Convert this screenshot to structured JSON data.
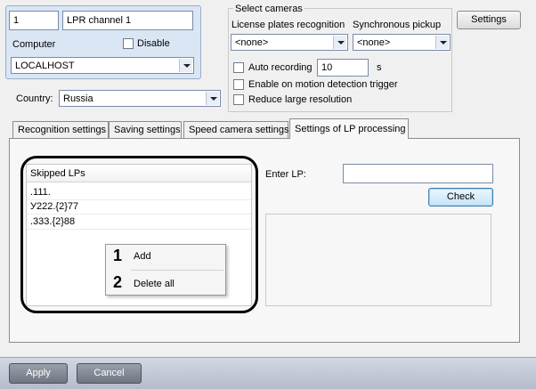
{
  "channel": {
    "id": "1",
    "name": "LPR channel 1",
    "computer_label": "Computer",
    "disable_label": "Disable",
    "disable_checked": false,
    "computer_value": "LOCALHOST"
  },
  "country": {
    "label": "Country:",
    "value": "Russia"
  },
  "select_cameras": {
    "title": "Select cameras",
    "lpr_label": "License plates recognition",
    "lpr_value": "<none>",
    "sync_label": "Synchronous pickup",
    "sync_value": "<none>",
    "auto_recording_label": "Auto recording",
    "auto_recording_value": "10",
    "auto_recording_unit": "s",
    "motion_trigger_label": "Enable on motion detection trigger",
    "reduce_resolution_label": "Reduce large resolution"
  },
  "settings_button": "Settings",
  "tabs": [
    {
      "label": "Recognition settings",
      "active": false
    },
    {
      "label": "Saving settings",
      "active": false
    },
    {
      "label": "Speed camera settings",
      "active": false
    },
    {
      "label": "Settings of LP processing",
      "active": true
    }
  ],
  "skipped_lps": {
    "header": "Skipped LPs",
    "items": [
      ".111.",
      "У222.{2}77",
      ".333.{2}88"
    ]
  },
  "context_menu": {
    "items": [
      {
        "number": "1",
        "label": "Add"
      },
      {
        "number": "2",
        "label": "Delete all"
      }
    ]
  },
  "enter_lp": {
    "label": "Enter LP:",
    "value": "",
    "check_button": "Check"
  },
  "footer": {
    "apply": "Apply",
    "cancel": "Cancel"
  },
  "colors": {
    "panel_blue": "#dbe6f5",
    "focus_blue": "#3c7fb1",
    "bottom_bar": "#b4bccb"
  }
}
